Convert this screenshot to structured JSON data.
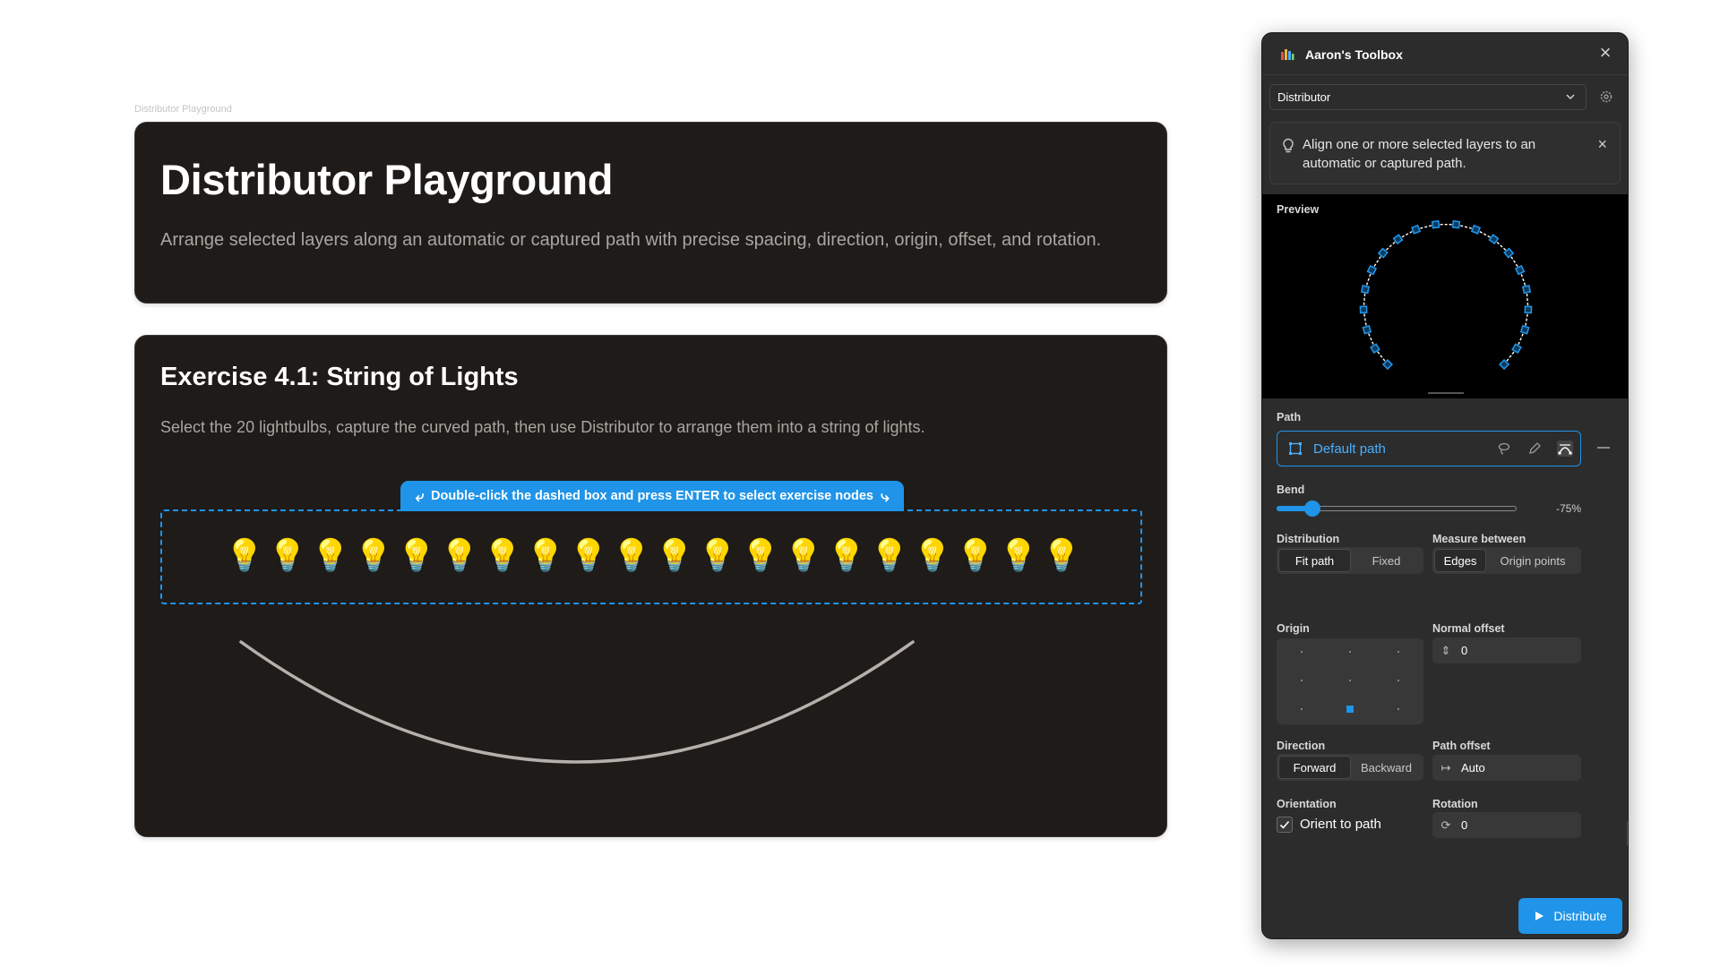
{
  "canvas": {
    "frame_label": "Distributor Playground"
  },
  "hero": {
    "title": "Distributor Playground",
    "description": "Arrange selected layers along an automatic or captured path with precise spacing, direction, origin, offset, and rotation."
  },
  "exercise": {
    "title": "Exercise 4.1: String of Lights",
    "description": "Select the 20 lightbulbs, capture the curved path, then use Distributor to arrange them into a string of lights.",
    "hint": "Double-click the dashed box and press ENTER to select exercise nodes",
    "bulb_glyph": "💡",
    "bulb_count": 20,
    "colors": {
      "accent": "#1f94e8",
      "card_bg": "#1e1b19",
      "curve": "#b5b0ab"
    }
  },
  "panel": {
    "title": "Aaron's Toolbox",
    "tool": "Distributor",
    "info": "Align one or more selected layers to an automatic or captured path.",
    "preview_label": "Preview",
    "path_label": "Path",
    "path_value": "Default path",
    "bend_label": "Bend",
    "bend_value": "-75%",
    "bend_fraction": 0.15,
    "distribution_label": "Distribution",
    "distribution_options": [
      "Fit path",
      "Fixed"
    ],
    "measure_label": "Measure between",
    "measure_options": [
      "Edges",
      "Origin points"
    ],
    "origin_label": "Origin",
    "normal_offset_label": "Normal offset",
    "normal_offset_value": "0",
    "direction_label": "Direction",
    "direction_options": [
      "Forward",
      "Backward"
    ],
    "path_offset_label": "Path offset",
    "path_offset_value": "Auto",
    "orientation_label": "Orientation",
    "orient_label": "Orient to path",
    "rotation_label": "Rotation",
    "rotation_value": "0",
    "distribute_label": "Distribute",
    "accent": "#1f94e8"
  }
}
